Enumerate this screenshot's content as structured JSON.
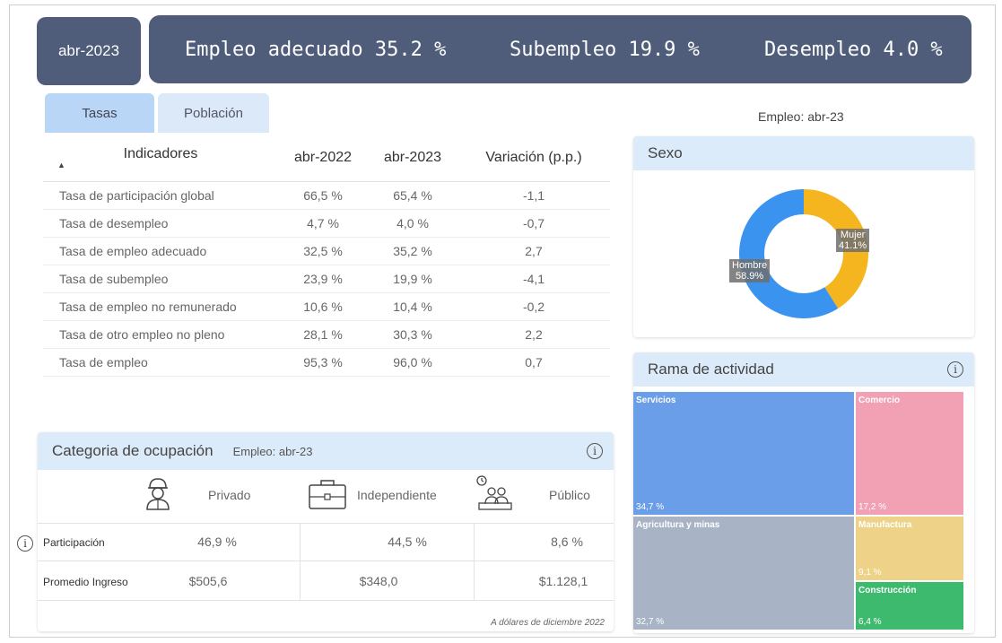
{
  "period": "abr-2023",
  "kpis": {
    "empleo_adecuado": "Empleo adecuado 35.2 %",
    "subempleo": "Subempleo 19.9 %",
    "desempleo": "Desempleo 4.0 %"
  },
  "tabs": [
    {
      "label": "Tasas",
      "active": true
    },
    {
      "label": "Población",
      "active": false
    }
  ],
  "empleo_label": "Empleo: abr-23",
  "indicators_table": {
    "headers": [
      "Indicadores",
      "abr-2022",
      "abr-2023",
      "Variación (p.p.)"
    ],
    "sort_glyph": "▲",
    "rows": [
      [
        "Tasa de participación global",
        "66,5 %",
        "65,4 %",
        "-1,1"
      ],
      [
        "Tasa de desempleo",
        "4,7 %",
        "4,0 %",
        "-0,7"
      ],
      [
        "Tasa de empleo adecuado",
        "32,5 %",
        "35,2 %",
        "2,7"
      ],
      [
        "Tasa de subempleo",
        "23,9 %",
        "19,9 %",
        "-4,1"
      ],
      [
        "Tasa de empleo no remunerado",
        "10,6 %",
        "10,4 %",
        "-0,2"
      ],
      [
        "Tasa de otro empleo no pleno",
        "28,1 %",
        "30,3 %",
        "2,2"
      ],
      [
        "Tasa de empleo",
        "95,3 %",
        "96,0 %",
        "0,7"
      ]
    ]
  },
  "sexo": {
    "title": "Sexo",
    "slices": [
      {
        "label": "Mujer",
        "value": 41.1,
        "display": "41.1%",
        "color": "#f5b51f"
      },
      {
        "label": "Hombre",
        "value": 58.9,
        "display": "58.9%",
        "color": "#3b93f0"
      }
    ]
  },
  "rama": {
    "title": "Rama de actividad",
    "info_glyph": "i",
    "items": [
      {
        "name": "Servicios",
        "display": "34,7 %",
        "color": "#6b9ee8"
      },
      {
        "name": "Comercio",
        "display": "17,2 %",
        "color": "#f2a0b4"
      },
      {
        "name": "Agricultura y minas",
        "display": "32,7 %",
        "color": "#a8b4c6"
      },
      {
        "name": "Manufactura",
        "display": "9,1 %",
        "color": "#edd288"
      },
      {
        "name": "Construcción",
        "display": "6,4 %",
        "color": "#3dba6e"
      }
    ]
  },
  "categoria": {
    "title": "Categoria de ocupación",
    "subtitle": "Empleo: abr-23",
    "info_glyph": "i",
    "columns": [
      "Privado",
      "Independiente",
      "Público"
    ],
    "rows": [
      {
        "label": "Participación",
        "values": [
          "46,9 %",
          "44,5 %",
          "8,6 %"
        ]
      },
      {
        "label": "Promedio Ingreso",
        "values": [
          "$505,6",
          "$348,0",
          "$1.128,1"
        ]
      }
    ],
    "footnote": "A dólares de diciembre 2022"
  },
  "side_info_glyph": "i"
}
